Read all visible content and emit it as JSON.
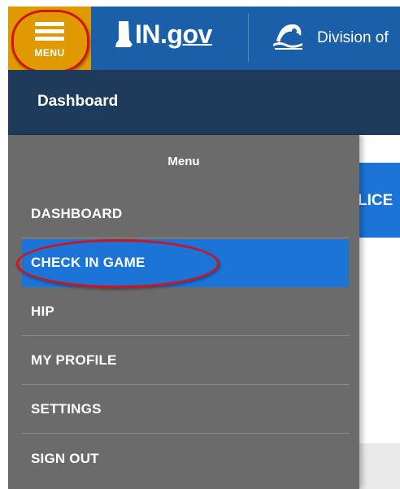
{
  "header": {
    "menu_button_label": "MENU",
    "ingov_prefix": "IN.",
    "ingov_suffix": "gov",
    "division_text": "Division of",
    "background_color": "#1b5fa8",
    "menu_button_color": "#e09a00"
  },
  "dashboard_bar": {
    "title": "Dashboard",
    "background_color": "#1f3b5c"
  },
  "background_page": {
    "banner_text": "LICE",
    "banner_color": "#1b74d6"
  },
  "menu": {
    "heading": "Menu",
    "panel_color": "#6b6b6b",
    "active_color": "#1b74d6",
    "items": [
      {
        "label": "DASHBOARD",
        "active": false
      },
      {
        "label": "CHECK IN GAME",
        "active": true
      },
      {
        "label": "HIP",
        "active": false
      },
      {
        "label": "MY PROFILE",
        "active": false
      },
      {
        "label": "SETTINGS",
        "active": false
      },
      {
        "label": "SIGN OUT",
        "active": false
      }
    ]
  },
  "annotations": {
    "highlight_color": "#d0141e"
  },
  "icons": {
    "menu": "hamburger-icon",
    "state": "indiana-state-icon",
    "dnr": "dnr-logo-icon"
  }
}
